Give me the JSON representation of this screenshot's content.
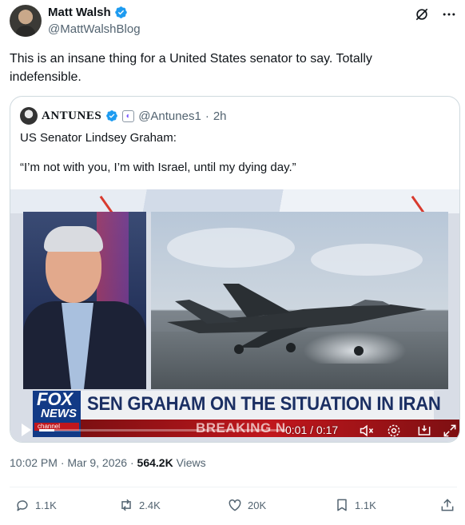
{
  "post": {
    "author": {
      "display_name": "Matt Walsh",
      "handle": "@MattWalshBlog",
      "verified": true
    },
    "text": "This is an insane thing for a United States senator to say. Totally indefensible.",
    "timestamp": "10:02 PM · Mar 9, 2026 · ",
    "views_count": "564.2K",
    "views_label": " Views"
  },
  "top_actions": {
    "grok_icon": "grok-icon",
    "more_icon": "more-icon"
  },
  "quote": {
    "author": {
      "display_name": "ANTUNES",
      "handle": "@Antunes1",
      "separator": "·",
      "time": "2h",
      "verified": true
    },
    "text_line1": "US Senator Lindsey Graham:",
    "text_line2": "“I’m not with you, I’m with Israel, until my dying day.”",
    "video": {
      "headline": "SEN GRAHAM ON THE SITUATION IN IRAN",
      "ticker": "BREAKING N",
      "logo_top": "FOX",
      "logo_bottom": "NEWS",
      "logo_channel": "channel",
      "current_time": "0:01",
      "duration": "0:17",
      "time_display": "0:01 / 0:17",
      "progress": 0.06
    }
  },
  "actions": {
    "replies": "1.1K",
    "reposts": "2.4K",
    "likes": "20K",
    "bookmarks": "1.1K"
  },
  "colors": {
    "verified_blue": "#1d9bf0",
    "secondary_text": "#536471",
    "fox_blue": "#123a86",
    "fox_red": "#c1171d"
  }
}
